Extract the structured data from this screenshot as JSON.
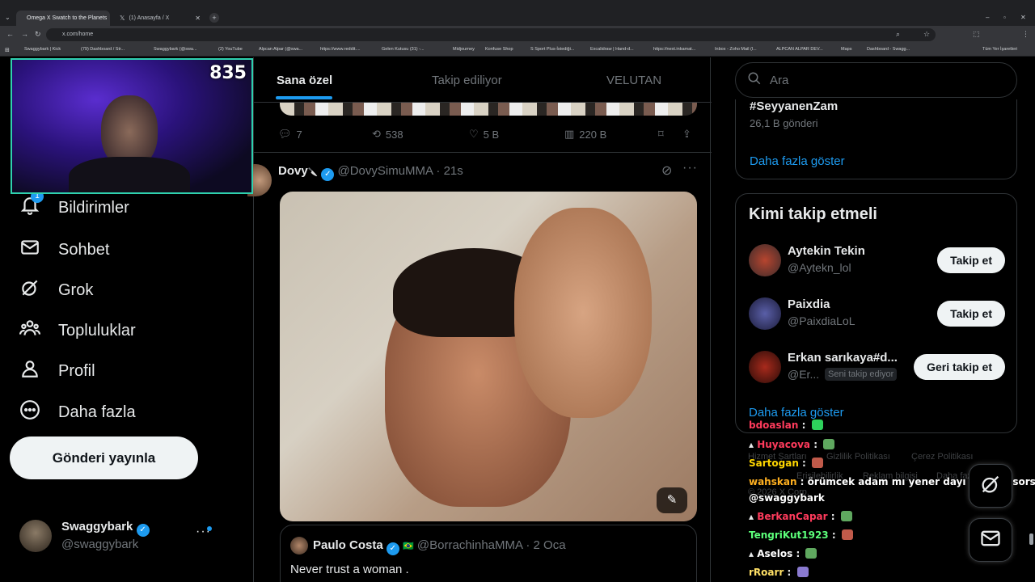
{
  "browser": {
    "tabs": [
      {
        "title": "Omega X Swatch to the Planets",
        "active": true
      },
      {
        "title": "(1) Anasayfa / X",
        "active": false
      }
    ],
    "url": "x.com/home",
    "bookmarks": [
      "Swaggybark | Kick",
      "(79) Dashboard / Str...",
      "Swaggybark (@swa...",
      "(2) YouTube",
      "Alpcan Alpar (@swa...",
      "https://www.reddit....",
      "Gelen Kutusu (31) -...",
      "Midjourney",
      "Konfuse Shop",
      "S Sport Plus-İstediği...",
      "Excalidraw | Hand-d...",
      "https://next.inkamat...",
      "Inbox - Zoho Mail (l...",
      "ALPCAN ALPAR DEV...",
      "Maps",
      "Dashboard - Swagg..."
    ],
    "all_bookmarks": "Tüm Yer İşaretleri"
  },
  "stream": {
    "viewer_count": "835"
  },
  "sidebar": {
    "notification_badge": "1",
    "items": [
      {
        "label": "Bildirimler",
        "icon": "bell-icon"
      },
      {
        "label": "Sohbet",
        "icon": "mail-icon"
      },
      {
        "label": "Grok",
        "icon": "grok-icon"
      },
      {
        "label": "Topluluklar",
        "icon": "communities-icon"
      },
      {
        "label": "Profil",
        "icon": "person-icon"
      },
      {
        "label": "Daha fazla",
        "icon": "more-circle-icon"
      }
    ],
    "post_button": "Gönderi yayınla",
    "account": {
      "name": "Swaggybark",
      "handle": "@swaggybark"
    }
  },
  "feed": {
    "tabs": [
      "Sana özel",
      "Takip ediliyor",
      "VELUTAN"
    ],
    "prev_tweet": {
      "replies": "7",
      "reposts": "538",
      "likes": "5 B",
      "views": "220 B"
    },
    "tweet": {
      "name": "Dovy",
      "name_emoji": "🔪",
      "handle": "@DovySimuMMA",
      "time": "· 21s",
      "quote": {
        "name": "Paulo Costa",
        "flag": "🇧🇷",
        "handle": "@BorrachinhaMMA",
        "time": "· 2 Oca",
        "text": "Never trust a woman ."
      }
    }
  },
  "right": {
    "search_placeholder": "Ara",
    "trend": {
      "tag": "#SeyyanenZam",
      "count": "26,1 B gönderi",
      "more": "Daha fazla göster"
    },
    "who_to_follow": {
      "title": "Kimi takip etmeli",
      "users": [
        {
          "name": "Aytekin Tekin",
          "handle": "@Aytekn_lol",
          "button": "Takip et"
        },
        {
          "name": "Paixdia",
          "handle": "@PaixdiaLoL",
          "button": "Takip et"
        },
        {
          "name": "Erkan sarıkaya#d...",
          "handle": "@Er...",
          "badge": "Seni takip ediyor",
          "button": "Geri takip et"
        }
      ],
      "more": "Daha fazla göster"
    },
    "footer": [
      "Hizmet Şartları",
      "Gizlilik Politikası",
      "Çerez Politikası",
      "Erişilebilirlik",
      "Reklam bilgisi",
      "Daha fazla",
      "© 2026 X Corp."
    ]
  },
  "chat": [
    {
      "user": "bdoaslan",
      "msg": "",
      "color": "#ff3b5c"
    },
    {
      "user": "Huyacova",
      "msg": "",
      "color": "#ff3b5c"
    },
    {
      "user": "Sartogan",
      "msg": "",
      "color": "#ffd700"
    },
    {
      "user": "wahskan",
      "msg": "örümcek adam mı yener dayı mı diye sorsun dayı",
      "color": "#ffb020"
    },
    {
      "user": "",
      "msg": "@swaggybark",
      "color": "#ffffff"
    },
    {
      "user": "BerkanCapar",
      "msg": "",
      "color": "#ff3b5c"
    },
    {
      "user": "TengriKut1923",
      "msg": "",
      "color": "#5cff7a"
    },
    {
      "user": "Aselos",
      "msg": "",
      "color": "#ffffff"
    },
    {
      "user": "rRoarr",
      "msg": "",
      "color": "#ffe066"
    }
  ],
  "colors": {
    "accent": "#1d9bf0",
    "background": "#000000",
    "border": "#2f3336",
    "muted": "#71767b"
  }
}
